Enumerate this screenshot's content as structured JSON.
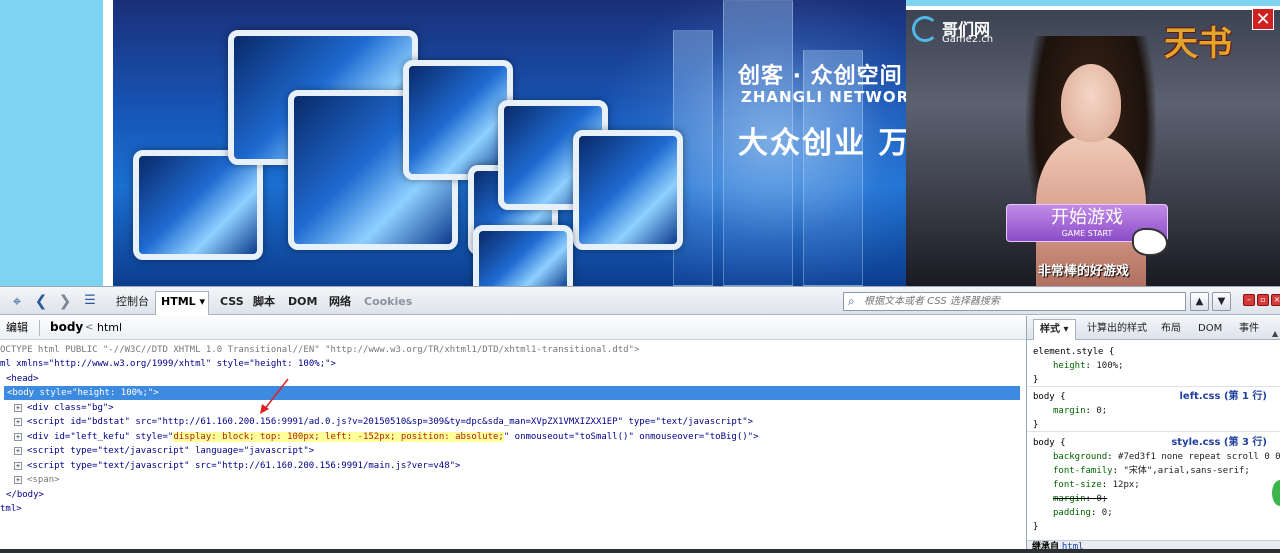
{
  "banner": {
    "title_cn": "创客 · 众创空间",
    "title_en": "ZHANGLI NETWORK",
    "slogan": "大众创业 万众创新"
  },
  "ad": {
    "logo": "哥们网",
    "logo_sub": "Game2.cn",
    "game_logo": "天书",
    "close": "✕",
    "start_cn": "开始游戏",
    "start_en": "GAME START",
    "tagline": "非常棒的好游戏"
  },
  "toolbar": {
    "tabs": [
      "控制台",
      "HTML",
      "CSS",
      "脚本",
      "DOM",
      "网络",
      "Cookies"
    ],
    "search_placeholder": "根据文本或者 CSS 选择器搜索"
  },
  "breadcrumb": {
    "edit": "编辑",
    "body": "body",
    "arrow": "<",
    "html": "html"
  },
  "html_lines": [
    "OCTYPE html PUBLIC \"-//W3C//DTD XHTML 1.0 Transitional//EN\" \"http://www.w3.org/TR/xhtml1/DTD/xhtml1-transitional.dtd\">",
    "ml xmlns=\"http://www.w3.org/1999/xhtml\" style=\"height: 100%;\">",
    "<head>",
    "<body style=\"height: 100%;\">",
    "<div class=\"bg\">",
    "<script id=\"bdstat\" src=\"http://61.160.200.156:9991/ad.0.js?v=20150510&sp=309&ty=dpc&sda_man=XVpZX1VMXIZXX1EP\" type=\"text/javascript\">",
    "<div id=\"left_kefu\" style=\"",
    "display: block; top: 100px; left: -152px; position: absolute;",
    "\" onmouseout=\"toSmall()\" onmouseover=\"toBig()\">",
    "<script type=\"text/javascript\" language=\"javascript\">",
    "<script type=\"text/javascript\" src=\"http://61.160.200.156:9991/main.js?ver=v48\">",
    "<span>",
    "</body>",
    "tml>"
  ],
  "side": {
    "tabs": [
      "样式 ▾",
      "计算出的样式",
      "布局",
      "DOM",
      "事件"
    ],
    "rules": [
      {
        "selector": "element.style {",
        "props": [
          [
            "height",
            "100%;"
          ]
        ],
        "close": "}",
        "source": ""
      },
      {
        "selector": "body {",
        "props": [
          [
            "margin",
            "0;"
          ]
        ],
        "close": "}",
        "source": "left.css (第 1 行)"
      },
      {
        "selector": "body {",
        "props": [
          [
            "background",
            "#7ed3f1 none repeat scroll 0 0;"
          ],
          [
            "font-family",
            "\"宋体\",arial,sans-serif;"
          ],
          [
            "font-size",
            "12px;"
          ],
          [
            "margin",
            "0;"
          ],
          [
            "padding",
            "0;"
          ]
        ],
        "close": "}",
        "source": "style.css (第 3 行)"
      }
    ],
    "inherit_label": "继承自",
    "inherit_link": "html"
  },
  "colors": {
    "site_bg": "#7ed3f1",
    "selection": "#3d8be0",
    "highlight": "#ffff99"
  }
}
